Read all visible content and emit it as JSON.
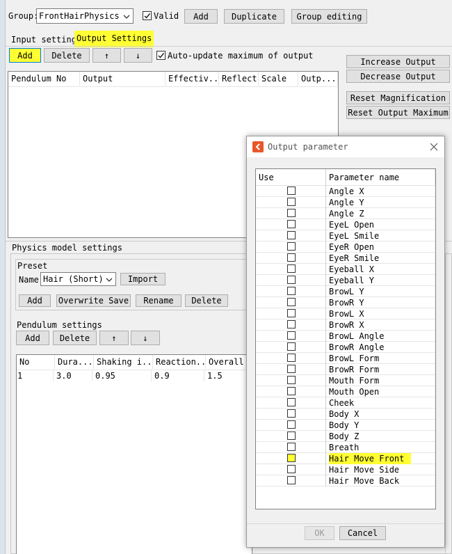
{
  "toolbar": {
    "group_label": "Group:",
    "group_value": "FrontHairPhysics",
    "valid_label": "Valid",
    "valid_checked": true,
    "add": "Add",
    "duplicate": "Duplicate",
    "group_editing": "Group editing"
  },
  "tabs": {
    "input": "Input settings",
    "output": "Output Settings"
  },
  "output_toolbar": {
    "add": "Add",
    "delete": "Delete",
    "up": "↑",
    "down": "↓",
    "auto_update": "Auto-update maximum of output",
    "auto_update_checked": true
  },
  "output_table": {
    "headers": [
      "Pendulum No",
      "Output",
      "Effectiv...",
      "Reflect",
      "Scale",
      "Outp..."
    ]
  },
  "right_buttons": {
    "increase": "Increase Output",
    "decrease": "Decrease Output",
    "reset_mag": "Reset Magnification",
    "reset_max": "Reset Output Maximum"
  },
  "physics": {
    "title": "Physics model settings",
    "preset_title": "Preset",
    "name_label": "Name:",
    "name_value": "Hair (Short)",
    "import": "Import",
    "add": "Add",
    "overwrite": "Overwrite Save",
    "rename": "Rename",
    "delete": "Delete",
    "pendulum_title": "Pendulum settings",
    "p_add": "Add",
    "p_delete": "Delete",
    "p_up": "↑",
    "p_down": "↓",
    "headers": [
      "No",
      "Dura...",
      "Shaking i...",
      "Reaction...",
      "Overall a"
    ],
    "rows": [
      [
        "1",
        "3.0",
        "0.95",
        "0.9",
        "1.5"
      ]
    ]
  },
  "dialog": {
    "title": "Output parameter",
    "col_use": "Use",
    "col_name": "Parameter name",
    "params": [
      "Angle X",
      "Angle Y",
      "Angle Z",
      "EyeL Open",
      "EyeL Smile",
      "EyeR Open",
      "EyeR Smile",
      "Eyeball X",
      "Eyeball Y",
      "BrowL Y",
      "BrowR Y",
      "BrowL X",
      "BrowR X",
      "BrowL Angle",
      "BrowR Angle",
      "BrowL Form",
      "BrowR Form",
      "Mouth Form",
      "Mouth Open",
      "Cheek",
      "Body X",
      "Body Y",
      "Body Z",
      "Breath",
      "Hair Move Front",
      "Hair Move Side",
      "Hair Move Back"
    ],
    "highlighted": "Hair Move Front",
    "ok": "OK",
    "cancel": "Cancel"
  },
  "colors": {
    "highlight": "#ffff33",
    "accent": "#0078d7",
    "dialog_icon": "#e8572a"
  }
}
